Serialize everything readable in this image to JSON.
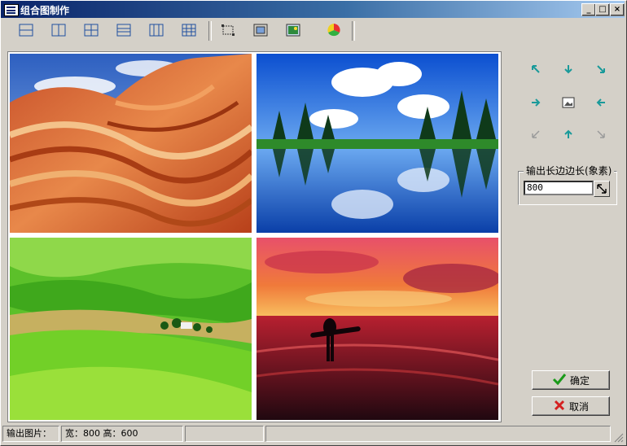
{
  "window": {
    "title": "组合图制作",
    "controls": {
      "minimize": "_",
      "maximize": "□",
      "close": "×"
    }
  },
  "toolbar": {
    "buttons": [
      {
        "name": "layout-2-rows-icon"
      },
      {
        "name": "layout-2-cols-icon"
      },
      {
        "name": "layout-2x2-icon"
      },
      {
        "name": "layout-3-rows-icon"
      },
      {
        "name": "layout-3-cols-icon"
      },
      {
        "name": "layout-3x3-icon"
      },
      {
        "name": "crop-select-icon"
      },
      {
        "name": "fit-frame-icon"
      },
      {
        "name": "image-frame-icon"
      },
      {
        "name": "color-wheel-icon"
      }
    ]
  },
  "images": [
    {
      "name": "red-rock-waves-photo"
    },
    {
      "name": "mountain-lake-reflection-photo"
    },
    {
      "name": "green-rolling-hills-photo"
    },
    {
      "name": "sunset-surfer-beach-photo"
    }
  ],
  "side": {
    "arrows": [
      "nw-arrow-icon",
      "up-arrow-icon",
      "ne-arrow-icon",
      "right-arrow-icon",
      "image-center-icon",
      "left-arrow-icon",
      "sw-arrow-icon",
      "down-arrow-icon",
      "se-arrow-icon"
    ],
    "output_label": "输出长边边长(象素)",
    "output_value": "800",
    "ok_label": "确定",
    "cancel_label": "取消"
  },
  "status": {
    "label": "输出图片：",
    "size_text": "宽：800 高：600",
    "panel3": "",
    "panel4": ""
  },
  "colors": {
    "titlebar": "#0a246a",
    "ok_check": "#1a9a1a",
    "cancel_x": "#d42020"
  }
}
